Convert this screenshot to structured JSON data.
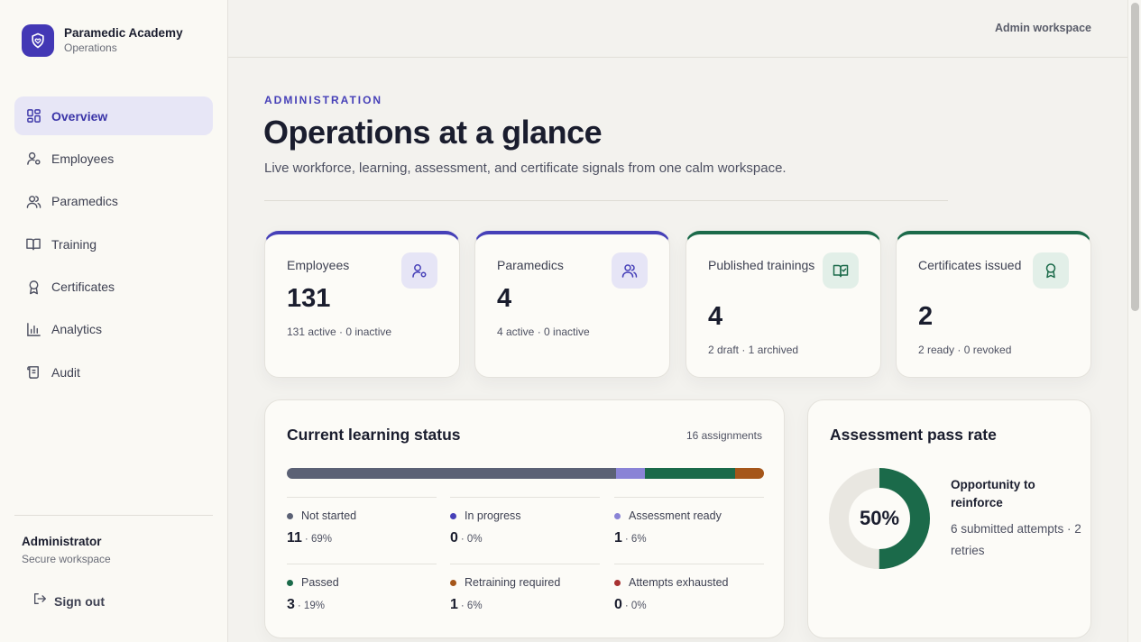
{
  "brand": {
    "name": "Paramedic Academy",
    "subtitle": "Operations"
  },
  "nav": [
    {
      "label": "Overview",
      "icon": "grid-icon",
      "active": true
    },
    {
      "label": "Employees",
      "icon": "user-gear-icon",
      "active": false
    },
    {
      "label": "Paramedics",
      "icon": "users-icon",
      "active": false
    },
    {
      "label": "Training",
      "icon": "book-icon",
      "active": false
    },
    {
      "label": "Certificates",
      "icon": "award-icon",
      "active": false
    },
    {
      "label": "Analytics",
      "icon": "bar-chart-icon",
      "active": false
    },
    {
      "label": "Audit",
      "icon": "scroll-icon",
      "active": false
    }
  ],
  "user": {
    "name": "Administrator",
    "subtitle": "Secure workspace",
    "signout_label": "Sign out"
  },
  "header": {
    "workspace_label": "Admin workspace"
  },
  "page": {
    "eyebrow": "ADMINISTRATION",
    "title": "Operations at a glance",
    "subtitle": "Live workforce, learning, assessment, and certificate signals from one calm workspace."
  },
  "stats": [
    {
      "label": "Employees",
      "value": "131",
      "note": "131 active · 0 inactive",
      "icon": "user-gear-icon"
    },
    {
      "label": "Paramedics",
      "value": "4",
      "note": "4 active · 0 inactive",
      "icon": "users-icon"
    },
    {
      "label": "Published trainings",
      "value": "4",
      "note": "2 draft · 1 archived",
      "icon": "book-check-icon"
    },
    {
      "label": "Certificates issued",
      "value": "2",
      "note": "2 ready · 0 revoked",
      "icon": "award-icon"
    }
  ],
  "learning": {
    "title": "Current learning status",
    "count_label": "16 assignments",
    "statuses": [
      {
        "label": "Not started",
        "count": "11",
        "pct": "· 69%",
        "share": 69,
        "color": "#5b6175"
      },
      {
        "label": "In progress",
        "count": "0",
        "pct": "· 0%",
        "share": 0,
        "color": "#4640b8"
      },
      {
        "label": "Assessment ready",
        "count": "1",
        "pct": "· 6%",
        "share": 6,
        "color": "#8a83d6"
      },
      {
        "label": "Passed",
        "count": "3",
        "pct": "· 19%",
        "share": 19,
        "color": "#1b6a4a"
      },
      {
        "label": "Retraining required",
        "count": "1",
        "pct": "· 6%",
        "share": 6,
        "color": "#a5561a"
      },
      {
        "label": "Attempts exhausted",
        "count": "0",
        "pct": "· 0%",
        "share": 0,
        "color": "#a83232"
      }
    ]
  },
  "assessment": {
    "title": "Assessment pass rate",
    "rate_label": "50%",
    "rate": 0.5,
    "headline": "Opportunity to reinforce",
    "note": "6 submitted attempts · 2 retries",
    "color": "#1b6a4a",
    "track_color": "#e9e7e1"
  }
}
